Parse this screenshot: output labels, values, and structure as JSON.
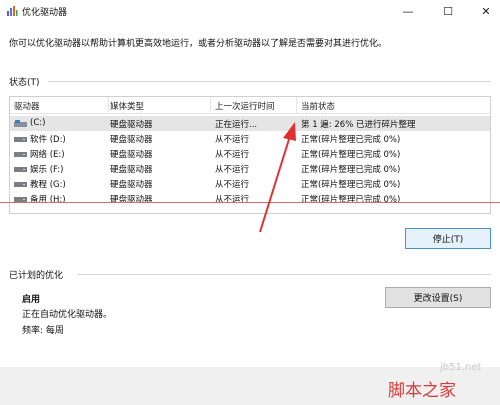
{
  "window": {
    "title": "优化驱动器",
    "controls": {
      "minimize": "—",
      "maximize": "☐",
      "close": "✕"
    }
  },
  "description": "你可以优化驱动器以帮助计算机更高效地运行，或者分析驱动器以了解是否需要对其进行优化。",
  "status_section": {
    "label": "状态(T)"
  },
  "table": {
    "columns": [
      "驱动器",
      "媒体类型",
      "上一次运行时间",
      "当前状态"
    ],
    "rows": [
      {
        "drive": "(C:)",
        "media": "硬盘驱动器",
        "last_run": "正在运行...",
        "status": "第 1 遍: 26% 已进行碎片整理",
        "selected": true
      },
      {
        "drive": "软件 (D:)",
        "media": "硬盘驱动器",
        "last_run": "从不运行",
        "status": "正常(碎片整理已完成 0%)"
      },
      {
        "drive": "网络 (E:)",
        "media": "硬盘驱动器",
        "last_run": "从不运行",
        "status": "正常(碎片整理已完成 0%)"
      },
      {
        "drive": "娱乐 (F:)",
        "media": "硬盘驱动器",
        "last_run": "从不运行",
        "status": "正常(碎片整理已完成 0%)"
      },
      {
        "drive": "教程 (G:)",
        "media": "硬盘驱动器",
        "last_run": "从不运行",
        "status": "正常(碎片整理已完成 0%)"
      },
      {
        "drive": "备用 (H:)",
        "media": "硬盘驱动器",
        "last_run": "从不运行",
        "status": "正常(碎片整理已完成 0%)"
      }
    ]
  },
  "stop_button": "停止(T)",
  "scheduled_section": {
    "label": "已计划的优化",
    "state": "启用",
    "detail": "正在自动优化驱动器。",
    "frequency": "频率: 每周",
    "change_button": "更改设置(S)"
  },
  "watermark": {
    "site": "jb51.net",
    "brand": "脚本之家"
  },
  "colors": {
    "annotation": "#e03030",
    "selection": "#e5e5e5",
    "focus_border": "#4a8fd6"
  }
}
